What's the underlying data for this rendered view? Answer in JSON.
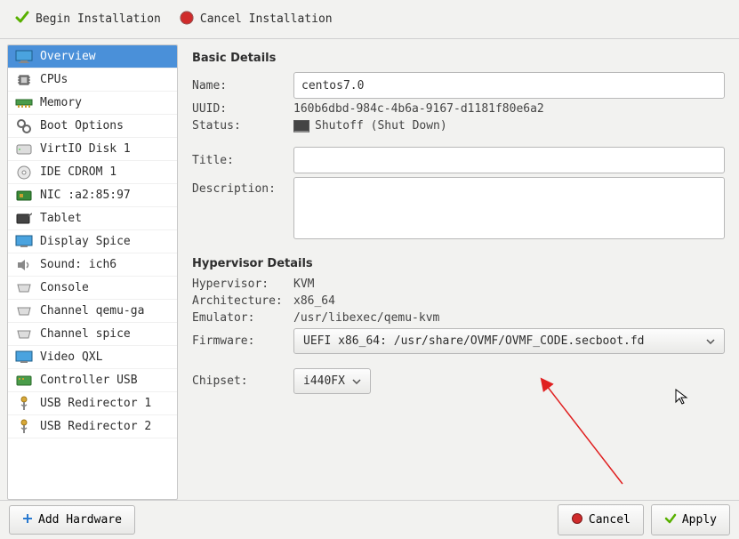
{
  "toolbar": {
    "begin_label": "Begin Installation",
    "cancel_label": "Cancel Installation"
  },
  "sidebar": {
    "items": [
      {
        "label": "Overview",
        "selected": true
      },
      {
        "label": "CPUs"
      },
      {
        "label": "Memory"
      },
      {
        "label": "Boot Options"
      },
      {
        "label": "VirtIO Disk 1"
      },
      {
        "label": "IDE CDROM 1"
      },
      {
        "label": "NIC :a2:85:97"
      },
      {
        "label": "Tablet"
      },
      {
        "label": "Display Spice"
      },
      {
        "label": "Sound: ich6"
      },
      {
        "label": "Console"
      },
      {
        "label": "Channel qemu-ga"
      },
      {
        "label": "Channel spice"
      },
      {
        "label": "Video QXL"
      },
      {
        "label": "Controller USB"
      },
      {
        "label": "USB Redirector 1"
      },
      {
        "label": "USB Redirector 2"
      }
    ]
  },
  "basic": {
    "heading": "Basic Details",
    "name_label": "Name:",
    "name_value": "centos7.0",
    "uuid_label": "UUID:",
    "uuid_value": "160b6dbd-984c-4b6a-9167-d1181f80e6a2",
    "status_label": "Status:",
    "status_value": "Shutoff (Shut Down)",
    "title_label": "Title:",
    "title_value": "",
    "desc_label": "Description:",
    "desc_value": ""
  },
  "hypervisor": {
    "heading": "Hypervisor Details",
    "hv_label": "Hypervisor:",
    "hv_value": "KVM",
    "arch_label": "Architecture:",
    "arch_value": "x86_64",
    "emu_label": "Emulator:",
    "emu_value": "/usr/libexec/qemu-kvm",
    "fw_label": "Firmware:",
    "fw_value": "UEFI x86_64: /usr/share/OVMF/OVMF_CODE.secboot.fd",
    "chipset_label": "Chipset:",
    "chipset_value": "i440FX"
  },
  "footer": {
    "add_hw_label": "Add Hardware",
    "cancel_label": "Cancel",
    "apply_label": "Apply"
  }
}
